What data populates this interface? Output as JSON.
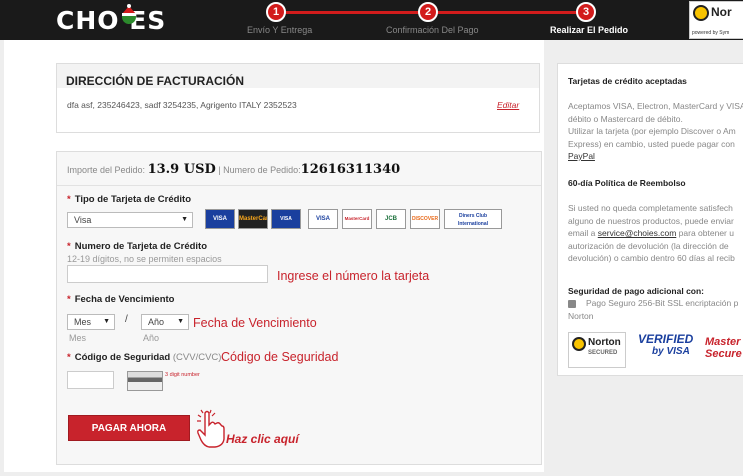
{
  "header": {
    "logo": "CHO  ES",
    "steps": [
      {
        "num": "1",
        "label": "Envío Y Entrega"
      },
      {
        "num": "2",
        "label": "Confirmación Del Pago"
      },
      {
        "num": "3",
        "label": "Realizar El Pedido"
      }
    ],
    "norton_top": {
      "name": "Nor",
      "sub": "powered by Sym"
    }
  },
  "billing": {
    "title": "DIRECCIÓN DE FACTURACIÓN",
    "address": "dfa asf, 235246423, sadf 3254235, Agrigento ITALY 2352523",
    "edit_label": "Editar"
  },
  "payment": {
    "amount_label": "Importe del Pedido:",
    "amount_value": "13.9 USD",
    "order_label": "Numero de Pedido:",
    "order_value": "12616311340",
    "card_type_label": "Tipo de Tarjeta de Crédito",
    "card_type_value": "Visa",
    "card_logos": [
      "VISA",
      "MasterCard",
      "VISA Electron",
      "VISA Debit",
      "MasterCard Debit",
      "JCB",
      "DISCOVER",
      "Diners Club International"
    ],
    "card_number_label": "Numero de Tarjeta de Crédito",
    "card_number_hint": "12-19 dígitos, no se permiten espacios",
    "card_number_annotation": "Ingrese el número la tarjeta",
    "expiry_label": "Fecha de Vencimiento",
    "month_value": "Mes",
    "month_hint": "Mes",
    "year_value": "Año",
    "year_hint": "Año",
    "expiry_annotation": "Fecha de Vencimiento",
    "cvv_label": "Código de Seguridad",
    "cvv_hint": "(CVV/CVC)",
    "cvv_annotation": "Código de Seguridad",
    "cvv_note": "3 digit number",
    "pay_button": "PAGAR AHORA",
    "click_annotation": "Haz clic aquí"
  },
  "sidebar": {
    "cards_title": "Tarjetas de crédito aceptadas",
    "cards_text_1": "Aceptamos VISA, Electron, MasterCard y VISA",
    "cards_text_2": "débito o Mastercard de débito.",
    "cards_text_3": "Utilizar la tarjeta (por ejemplo Discover o Am",
    "cards_text_4": "Express) en cambio, usted puede pagar con",
    "paypal_link": "PayPal",
    "refund_title": "60-día Política de Reembolso",
    "refund_text_1": "Si usted no queda completamente satisfech",
    "refund_text_2": "alguno de nuestros productos, puede enviar",
    "refund_text_3_pre": "email a ",
    "refund_email": "service@choies.com",
    "refund_text_3_post": " para obtener u",
    "refund_text_4": "autorización de devolución (la dirección de",
    "refund_text_5": "devolución) o cambio dentro 60 días al recib",
    "security_title": "Seguridad de pago adicional con:",
    "security_text_1": "Pago Seguro 256-Bit SSL encriptación p",
    "security_text_2": "Norton",
    "badge_norton": "Norton",
    "badge_norton_sub": "SECURED",
    "badge_visa_1": "VERIFIED",
    "badge_visa_2": "by VISA",
    "badge_master": "Master",
    "badge_master_2": "Secure"
  },
  "colors": {
    "accent": "#c8232c",
    "header_bg": "#1a1a1a"
  }
}
